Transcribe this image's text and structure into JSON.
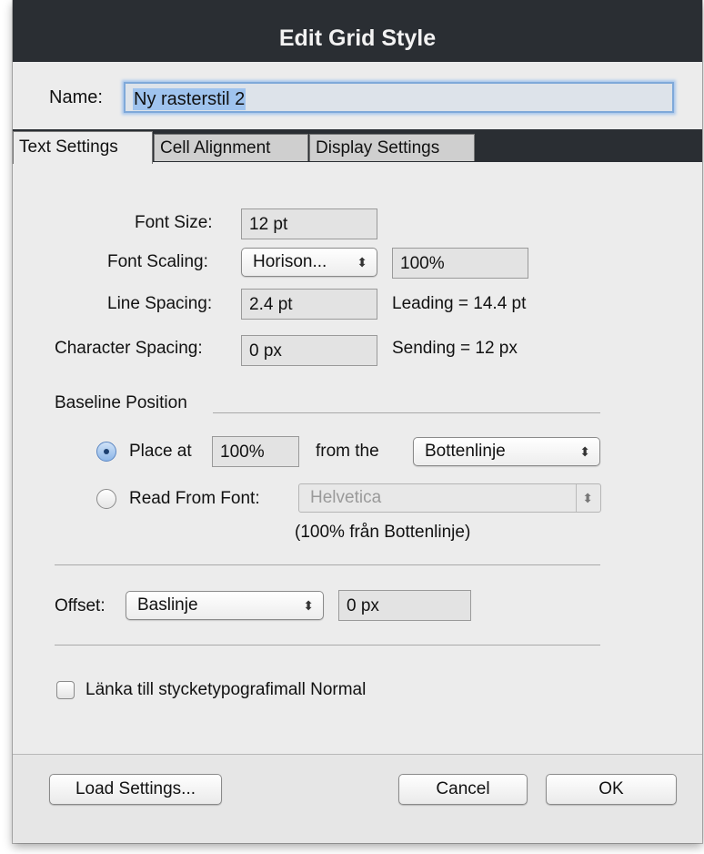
{
  "window": {
    "title": "Edit Grid Style"
  },
  "name": {
    "label": "Name:",
    "value": "Ny rasterstil 2"
  },
  "tabs": [
    {
      "label": "Text Settings",
      "active": true
    },
    {
      "label": "Cell Alignment",
      "active": false
    },
    {
      "label": "Display Settings",
      "active": false
    }
  ],
  "text_settings": {
    "font_size": {
      "label": "Font Size:",
      "value": "12 pt"
    },
    "font_scaling": {
      "label": "Font Scaling:",
      "mode": "Horison...",
      "value": "100%"
    },
    "line_spacing": {
      "label": "Line Spacing:",
      "value": "2.4 pt",
      "info": "Leading = 14.4 pt"
    },
    "character_spacing": {
      "label": "Character Spacing:",
      "value": "0 px",
      "info": "Sending = 12 px"
    },
    "baseline": {
      "section_label": "Baseline Position",
      "place_at": {
        "label": "Place at",
        "value": "100%",
        "from_label": "from the",
        "reference": "Bottenlinje",
        "selected": true
      },
      "read_from_font": {
        "label": "Read From Font:",
        "font": "Helvetica",
        "note": "(100% från Bottenlinje)",
        "selected": false
      }
    },
    "offset": {
      "label": "Offset:",
      "mode": "Baslinje",
      "value": "0 px"
    },
    "link_style": {
      "label": "Länka till stycketypografimall Normal",
      "checked": false
    }
  },
  "footer": {
    "load_settings": "Load Settings...",
    "cancel": "Cancel",
    "ok": "OK"
  },
  "icons": {
    "select_arrows": "⇕",
    "popup_arrows_glyph": "÷"
  }
}
